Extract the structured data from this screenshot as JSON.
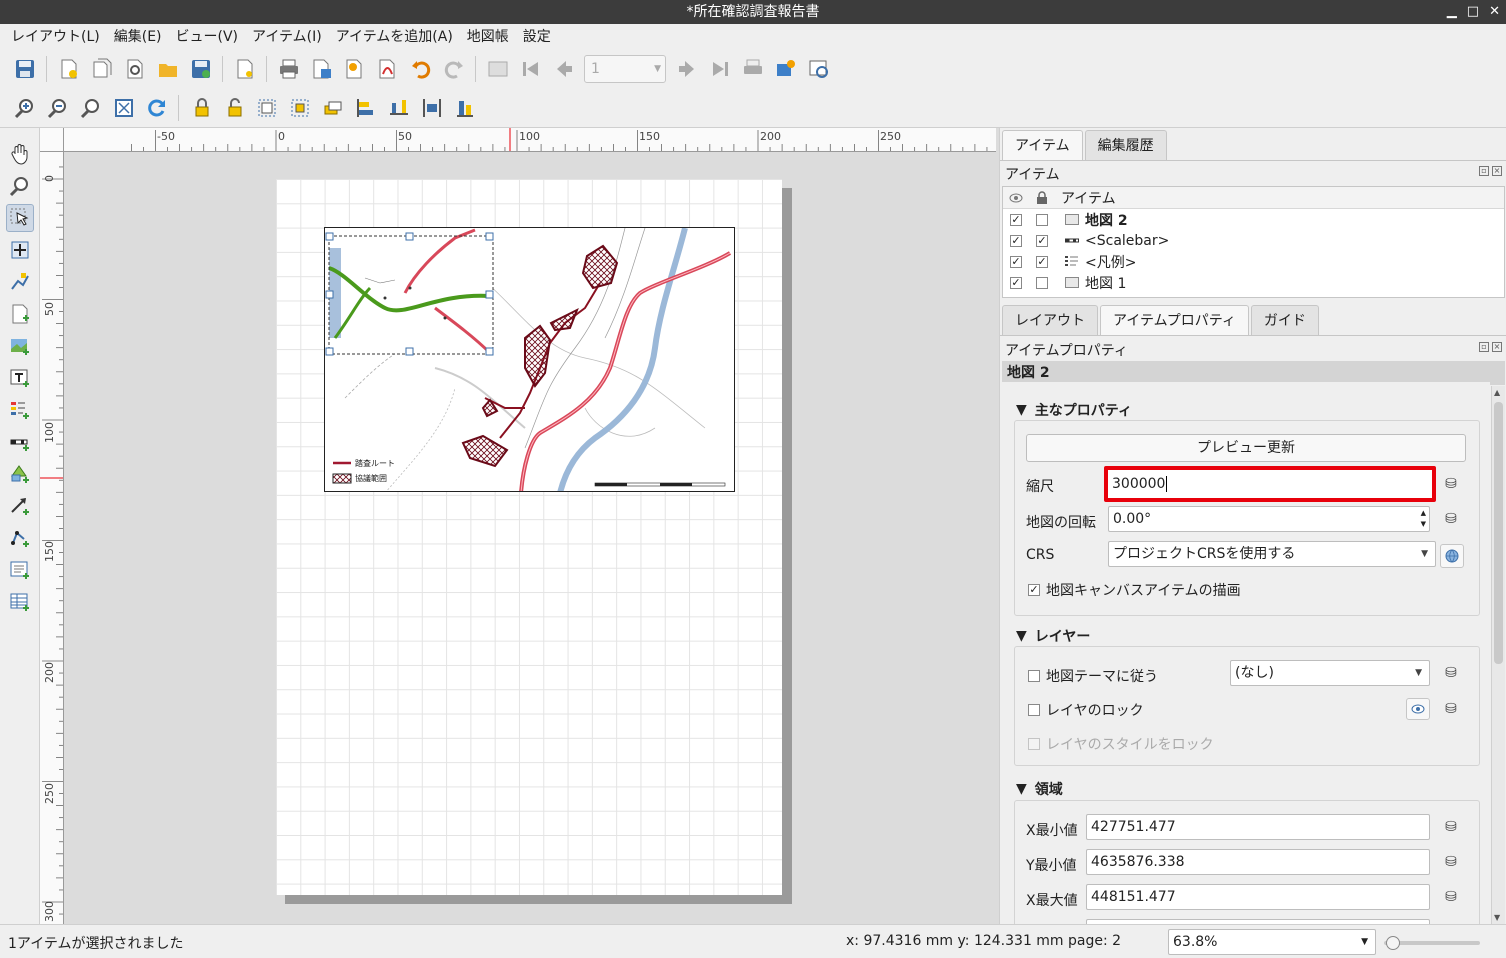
{
  "window": {
    "title": "*所在確認調査報告書"
  },
  "menu": [
    "レイアウト(L)",
    "編集(E)",
    "ビュー(V)",
    "アイテム(I)",
    "アイテムを追加(A)",
    "地図帳",
    "設定"
  ],
  "toolbar": {
    "page_value": "1"
  },
  "rulers": {
    "h_labels": [
      "-50",
      "0",
      "50",
      "100",
      "150",
      "200",
      "250"
    ],
    "v_labels": [
      "0",
      "50",
      "100",
      "150",
      "200",
      "250",
      "300"
    ]
  },
  "map_legend": {
    "route": "踏査ルート",
    "area": "協議範囲"
  },
  "dock": {
    "top_tabs": [
      "アイテム",
      "編集履歴"
    ],
    "items_panel_title": "アイテム",
    "items_column": "アイテム",
    "items": [
      {
        "name": "地図 2",
        "visible": true,
        "locked": false,
        "bold": true,
        "icon": "map-icon"
      },
      {
        "name": "<Scalebar>",
        "visible": true,
        "locked": true,
        "bold": false,
        "icon": "scalebar-icon"
      },
      {
        "name": "<凡例>",
        "visible": true,
        "locked": true,
        "bold": false,
        "icon": "legend-icon"
      },
      {
        "name": "地図 1",
        "visible": true,
        "locked": false,
        "bold": false,
        "icon": "map-icon"
      }
    ],
    "mid_tabs": [
      "レイアウト",
      "アイテムプロパティ",
      "ガイド"
    ],
    "props_panel_title": "アイテムプロパティ",
    "selected_item": "地図 2",
    "main_group": {
      "title": "主なプロパティ",
      "preview_button": "プレビュー更新",
      "scale_label": "縮尺",
      "scale_value": "300000",
      "rotation_label": "地図の回転",
      "rotation_value": "0.00°",
      "crs_label": "CRS",
      "crs_value": "プロジェクトCRSを使用する",
      "draw_canvas_items": "地図キャンバスアイテムの描画"
    },
    "layers_group": {
      "title": "レイヤー",
      "follow_theme": "地図テーマに従う",
      "theme_value": "(なし)",
      "lock_layers": "レイヤのロック",
      "lock_styles": "レイヤのスタイルをロック"
    },
    "extent_group": {
      "title": "領域",
      "xmin_label": "X最小値",
      "xmin_value": "427751.477",
      "ymin_label": "Y最小値",
      "ymin_value": "4635876.338",
      "xmax_label": "X最大値",
      "xmax_value": "448151.477"
    }
  },
  "status": {
    "message": "1アイテムが選択されました",
    "coords": "x: 97.4316 mm y: 124.331 mm page: 2",
    "zoom": "63.8%"
  },
  "colors": {
    "highlight": "#e8000b",
    "route": "#a01830",
    "river": "#9bb8d8",
    "road": "#d8485a",
    "green": "#4a9a1c"
  }
}
